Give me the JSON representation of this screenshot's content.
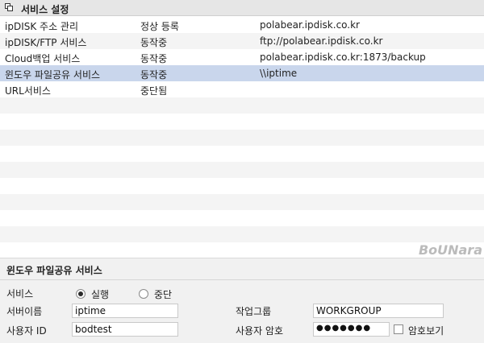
{
  "window": {
    "title": "서비스 설정"
  },
  "services": {
    "rows": [
      {
        "name": "ipDISK 주소 관리",
        "status": "정상 등록",
        "address": "polabear.ipdisk.co.kr"
      },
      {
        "name": "ipDISK/FTP 서비스",
        "status": "동작중",
        "address": "ftp://polabear.ipdisk.co.kr"
      },
      {
        "name": "Cloud백업 서비스",
        "status": "동작중",
        "address": "polabear.ipdisk.co.kr:1873/backup"
      },
      {
        "name": "윈도우 파일공유 서비스",
        "status": "동작중",
        "address": "\\\\iptime"
      },
      {
        "name": "URL서비스",
        "status": "중단됨",
        "address": ""
      }
    ],
    "selected_index": 3
  },
  "watermark": "BoUNara",
  "panel": {
    "title": "윈도우 파일공유 서비스",
    "service_label": "서비스",
    "radio_run": "실행",
    "radio_stop": "중단",
    "radio_selected": "실행",
    "server_name_label": "서버이름",
    "server_name_value": "iptime",
    "workgroup_label": "작업그룹",
    "workgroup_value": "WORKGROUP",
    "user_id_label": "사용자 ID",
    "user_id_value": "bodtest",
    "user_pw_label": "사용자 암호",
    "user_pw_value": "●●●●●●●",
    "show_password_label": "암호보기"
  }
}
